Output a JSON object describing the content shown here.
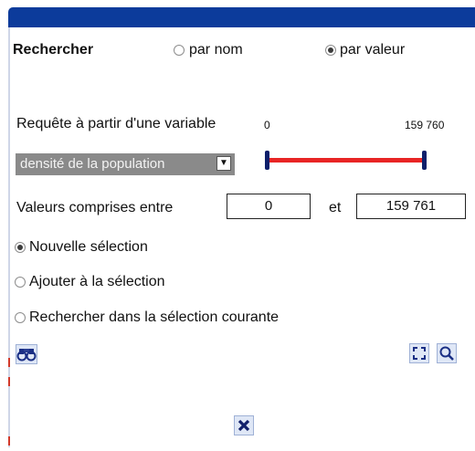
{
  "header": {
    "title": "Rechercher"
  },
  "search_mode": {
    "options": [
      {
        "label": "par nom",
        "selected": false
      },
      {
        "label": "par valeur",
        "selected": true
      }
    ]
  },
  "query": {
    "label": "Requête à partir d'une variable",
    "variable_selected": "densité de la population",
    "slider": {
      "min_label": "0",
      "max_label": "159 760",
      "min": 0,
      "max": 159760,
      "low": 0,
      "high": 159760
    }
  },
  "range": {
    "label": "Valeurs comprises entre",
    "from_value": "0",
    "and_label": "et",
    "to_value": "159 761"
  },
  "selection_mode": {
    "options": [
      {
        "label": "Nouvelle sélection",
        "selected": true
      },
      {
        "label": "Ajouter à la sélection",
        "selected": false
      },
      {
        "label": "Rechercher dans la sélection courante",
        "selected": false
      }
    ]
  },
  "icons": {
    "search": "binoculars-icon",
    "extent": "zoom-extent-icon",
    "zoom": "magnifier-icon",
    "close": "close-icon"
  },
  "colors": {
    "header_bar": "#0c3b9b",
    "slider_track": "#e82525",
    "slider_handle": "#0d1f6b",
    "select_bg": "#8a8a8a"
  }
}
